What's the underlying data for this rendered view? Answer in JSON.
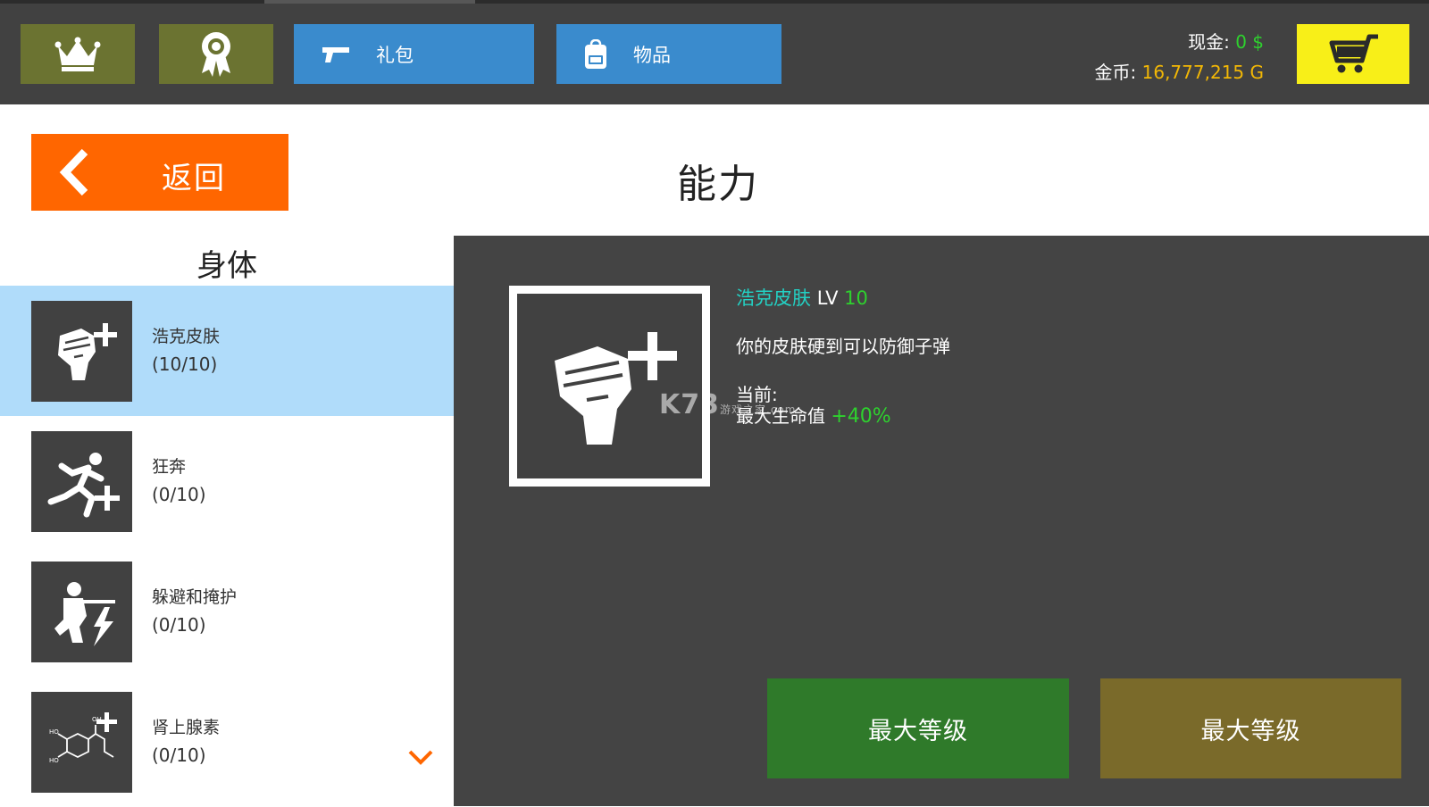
{
  "topbar": {
    "gift_label": "礼包",
    "items_label": "物品",
    "cash_label": "现金:",
    "cash_value": "0 $",
    "gold_label": "金币:",
    "gold_value": "16,777,215 G",
    "icons": [
      "crown-icon",
      "medal-icon",
      "pistol-icon",
      "backpack-icon",
      "cart-icon"
    ]
  },
  "back_label": "返回",
  "page_title": "能力",
  "section_title": "身体",
  "skills": [
    {
      "name": "浩克皮肤",
      "level": "(10/10)",
      "icon": "fist-plus-icon",
      "selected": true
    },
    {
      "name": "狂奔",
      "level": "(0/10)",
      "icon": "runner-plus-icon"
    },
    {
      "name": "躲避和掩护",
      "level": "(0/10)",
      "icon": "soldier-lightning-icon"
    },
    {
      "name": "肾上腺素",
      "level": "(0/10)",
      "icon": "molecule-plus-icon"
    }
  ],
  "detail": {
    "name": "浩克皮肤",
    "lv_label": "LV",
    "lv_value": "10",
    "description": "你的皮肤硬到可以防御子弹",
    "current_label": "当前:",
    "stat_label": "最大生命值",
    "stat_value": "+40%"
  },
  "watermark": {
    "main": "K73",
    "sub": "游戏之家",
    "suffix": ".com"
  },
  "actions": {
    "green_label": "最大等级",
    "olive_label": "最大等级"
  },
  "colors": {
    "topbar": "#414141",
    "olive": "#6b7331",
    "blue": "#3a8bcd",
    "cart": "#f8ef18",
    "back": "#ff6600",
    "selected_row": "#b0dcfa",
    "detail_bg": "#444444",
    "green_btn": "#2f7a2a",
    "olive_btn": "#7a6a2a"
  }
}
